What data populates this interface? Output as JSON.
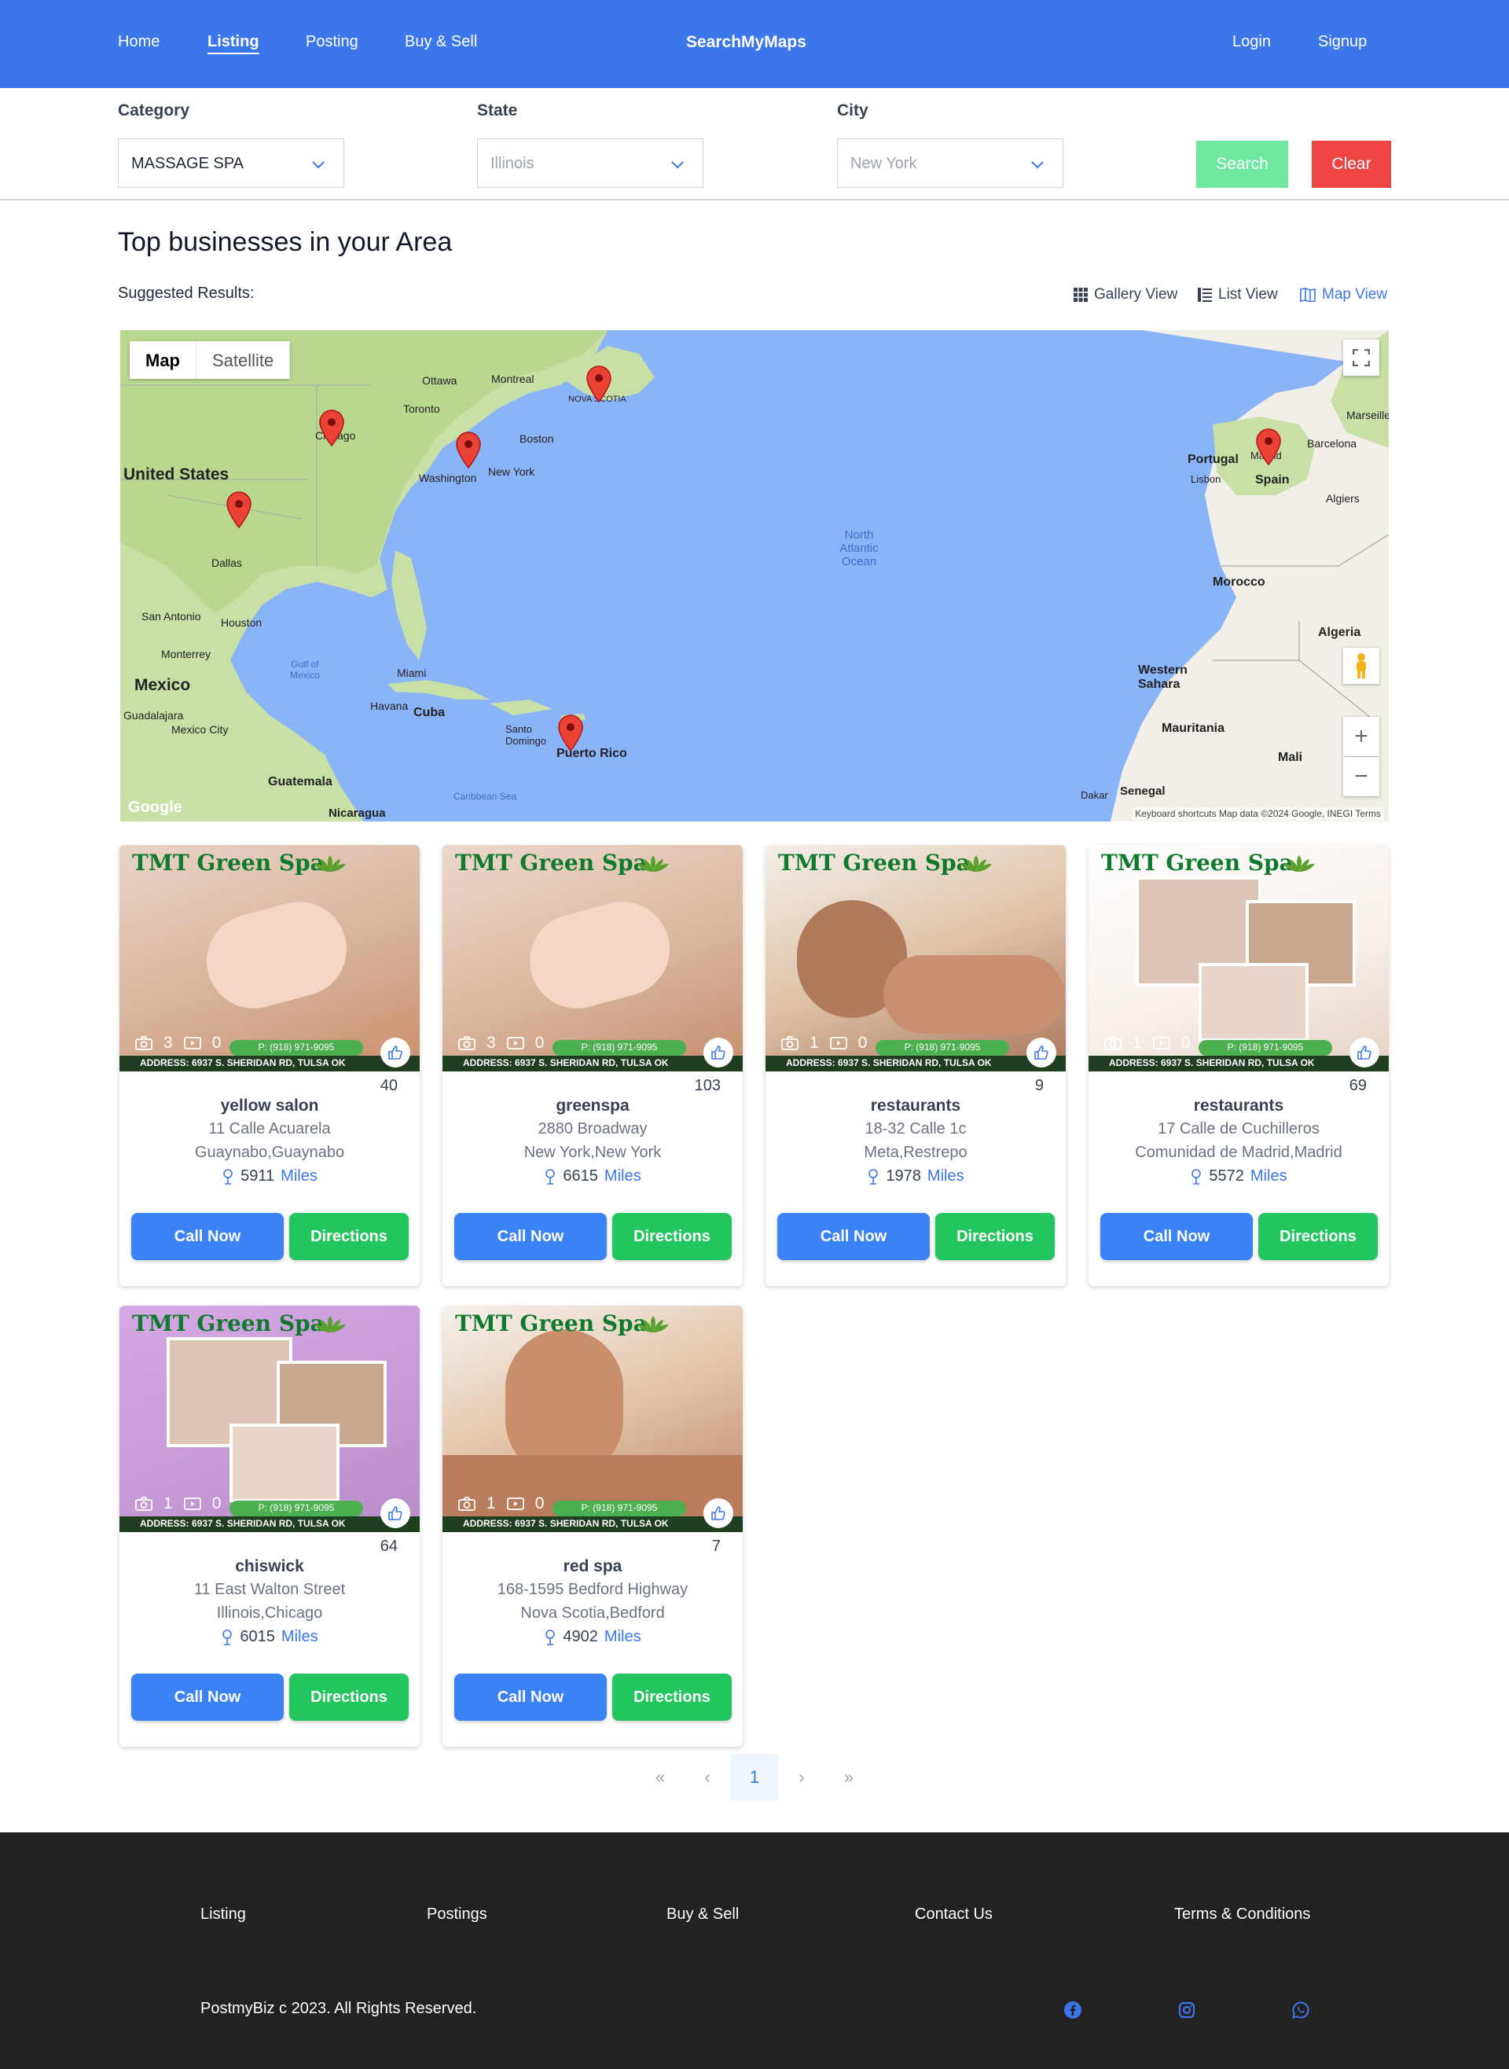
{
  "nav": {
    "home": "Home",
    "listing": "Listing",
    "posting": "Posting",
    "buy_sell": "Buy & Sell",
    "brand": "SearchMyMaps",
    "login": "Login",
    "signup": "Signup"
  },
  "filters": {
    "category_label": "Category",
    "category_value": "MASSAGE SPA",
    "state_label": "State",
    "state_placeholder": "Illinois",
    "city_label": "City",
    "city_placeholder": "New York",
    "search_label": "Search",
    "clear_label": "Clear"
  },
  "page_title": "Top businesses in your Area",
  "suggested_label": "Suggested Results:",
  "views": {
    "gallery": "Gallery View",
    "list": "List View",
    "map": "Map View",
    "active": "map"
  },
  "map": {
    "tab_map": "Map",
    "tab_satellite": "Satellite",
    "labels": {
      "united_states": "United States",
      "mexico": "Mexico",
      "cuba": "Cuba",
      "puerto_rico": "Puerto Rico",
      "spain": "Spain",
      "portugal": "Portugal",
      "morocco": "Morocco",
      "algeria": "Algeria",
      "western_sahara": "Western Sahara",
      "mauritania": "Mauritania",
      "mali": "Mali",
      "north_atlantic_ocean": "North Atlantic Ocean",
      "chicago": "Chicago",
      "washington": "Washington",
      "new_york": "New York",
      "boston": "Boston",
      "montreal": "Montreal",
      "ottawa": "Ottawa",
      "toronto": "Toronto",
      "dallas": "Dallas",
      "houston": "Houston",
      "san_antonio": "San Antonio",
      "miami": "Miami",
      "havana": "Havana",
      "mexico_city": "Mexico City",
      "guadalajara": "Guadalajara",
      "monterrey": "Monterrey",
      "guatemala": "Guatemala",
      "nicaragua": "Nicaragua",
      "santo_domingo": "Santo Domingo",
      "madrid": "Madrid",
      "lisbon": "Lisbon",
      "barcelona": "Barcelona",
      "marseille": "Marseille",
      "algiers": "Algiers",
      "dakar": "Dakar",
      "senegal": "Senegal",
      "gulf_of_mexico": "Gulf of Mexico",
      "caribbean_sea": "Caribbean Sea",
      "nova_scotia": "NOVA SCOTIA"
    },
    "attribution": "Keyboard shortcuts   Map data ©2024 Google, INEGI   Terms",
    "logo": "Google"
  },
  "card_brand": "TMT Green Spa",
  "card_phone": "P: (918) 971-9095",
  "card_address": "ADDRESS: 6937 S. SHERIDAN RD, TULSA OK",
  "card_call_label": "Call Now",
  "card_directions_label": "Directions",
  "miles_label": "Miles",
  "cards": [
    {
      "name": "yellow salon",
      "line1": "11 Calle Acuarela",
      "line2": "Guaynabo,Guaynabo",
      "distance": "5911",
      "likes": "40",
      "photos": "3",
      "videos": "0"
    },
    {
      "name": "greenspa",
      "line1": "2880 Broadway",
      "line2": "New York,New York",
      "distance": "6615",
      "likes": "103",
      "photos": "3",
      "videos": "0"
    },
    {
      "name": "restaurants",
      "line1": "18-32 Calle 1c",
      "line2": "Meta,Restrepo",
      "distance": "1978",
      "likes": "9",
      "photos": "1",
      "videos": "0"
    },
    {
      "name": "restaurants",
      "line1": "17 Calle de Cuchilleros",
      "line2": "Comunidad de Madrid,Madrid",
      "distance": "5572",
      "likes": "69",
      "photos": "1",
      "videos": "0"
    },
    {
      "name": "chiswick",
      "line1": "11 East Walton Street",
      "line2": "Illinois,Chicago",
      "distance": "6015",
      "likes": "64",
      "photos": "1",
      "videos": "0"
    },
    {
      "name": "red spa",
      "line1": "168-1595 Bedford Highway",
      "line2": "Nova Scotia,Bedford",
      "distance": "4902",
      "likes": "7",
      "photos": "1",
      "videos": "0"
    }
  ],
  "pagination": {
    "first": "«",
    "prev": "‹",
    "current": "1",
    "next": "›",
    "last": "»"
  },
  "footer": {
    "listing": "Listing",
    "postings": "Postings",
    "buy_sell": "Buy & Sell",
    "contact": "Contact Us",
    "terms": "Terms & Conditions",
    "copyright": "PostmyBiz c 2023. All Rights Reserved."
  },
  "colors": {
    "brand_blue": "#3b76ea",
    "call_blue": "#3b82f6",
    "directions_green": "#22c55e",
    "clear_red": "#ef4444",
    "search_green": "#6ee7a0",
    "footer_dark": "#222222"
  }
}
